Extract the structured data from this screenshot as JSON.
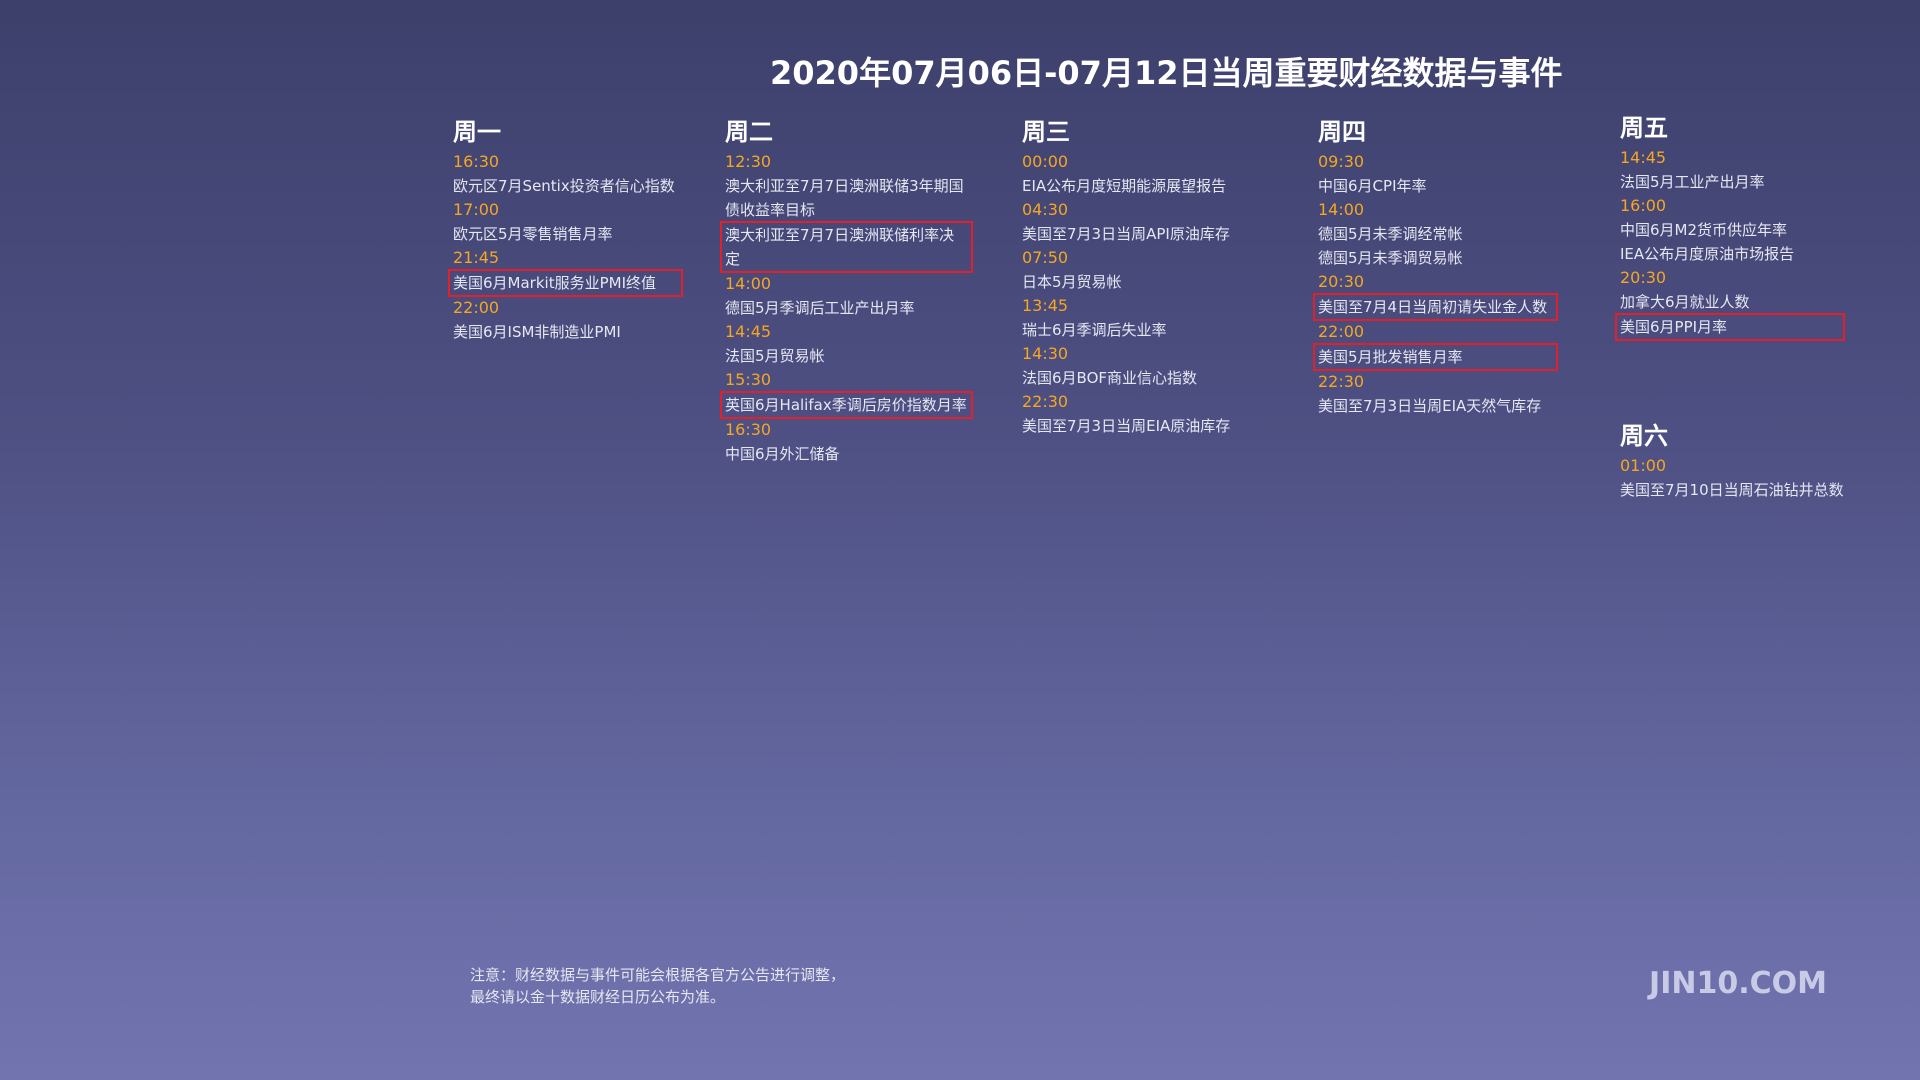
{
  "title": "2020年07月06日-07月12日当周重要财经数据与事件",
  "colors": {
    "time": "#f5a623",
    "highlight_border": "#e0202a",
    "text": "#e6e7f2"
  },
  "days": [
    {
      "name": "周一",
      "items": [
        {
          "time": "16:30",
          "events": [
            {
              "text": "欧元区7月Sentix投资者信心指数",
              "hl": false
            }
          ]
        },
        {
          "time": "17:00",
          "events": [
            {
              "text": "欧元区5月零售销售月率",
              "hl": false
            }
          ]
        },
        {
          "time": "21:45",
          "events": [
            {
              "text": "美国6月Markit服务业PMI终值",
              "hl": true
            }
          ]
        },
        {
          "time": "22:00",
          "events": [
            {
              "text": "美国6月ISM非制造业PMI",
              "hl": false
            }
          ]
        }
      ]
    },
    {
      "name": "周二",
      "items": [
        {
          "time": "12:30",
          "events": [
            {
              "text": "澳大利亚至7月7日澳洲联储3年期国债收益率目标",
              "hl": false
            },
            {
              "text": "澳大利亚至7月7日澳洲联储利率决定",
              "hl": true
            }
          ]
        },
        {
          "time": "14:00",
          "events": [
            {
              "text": "德国5月季调后工业产出月率",
              "hl": false
            }
          ]
        },
        {
          "time": "14:45",
          "events": [
            {
              "text": "法国5月贸易帐",
              "hl": false
            }
          ]
        },
        {
          "time": "15:30",
          "events": [
            {
              "text": "英国6月Halifax季调后房价指数月率",
              "hl": true
            }
          ]
        },
        {
          "time": "16:30",
          "events": [
            {
              "text": "中国6月外汇储备",
              "hl": false
            }
          ]
        }
      ]
    },
    {
      "name": "周三",
      "items": [
        {
          "time": "00:00",
          "events": [
            {
              "text": "EIA公布月度短期能源展望报告",
              "hl": false
            }
          ]
        },
        {
          "time": "04:30",
          "events": [
            {
              "text": "美国至7月3日当周API原油库存",
              "hl": false
            }
          ]
        },
        {
          "time": "07:50",
          "events": [
            {
              "text": "日本5月贸易帐",
              "hl": false
            }
          ]
        },
        {
          "time": "13:45",
          "events": [
            {
              "text": "瑞士6月季调后失业率",
              "hl": false
            }
          ]
        },
        {
          "time": "14:30",
          "events": [
            {
              "text": "法国6月BOF商业信心指数",
              "hl": false
            }
          ]
        },
        {
          "time": "22:30",
          "events": [
            {
              "text": "美国至7月3日当周EIA原油库存",
              "hl": false
            }
          ]
        }
      ]
    },
    {
      "name": "周四",
      "items": [
        {
          "time": "09:30",
          "events": [
            {
              "text": "中国6月CPI年率",
              "hl": false
            }
          ]
        },
        {
          "time": "14:00",
          "events": [
            {
              "text": "德国5月未季调经常帐",
              "hl": false
            },
            {
              "text": "德国5月未季调贸易帐",
              "hl": false
            }
          ]
        },
        {
          "time": "20:30",
          "events": [
            {
              "text": "美国至7月4日当周初请失业金人数",
              "hl": true
            }
          ]
        },
        {
          "time": "22:00",
          "events": [
            {
              "text": "美国5月批发销售月率",
              "hl": true
            }
          ]
        },
        {
          "time": "22:30",
          "events": [
            {
              "text": "美国至7月3日当周EIA天然气库存",
              "hl": false
            }
          ]
        }
      ]
    },
    {
      "name": "周五",
      "items": [
        {
          "time": "14:45",
          "events": [
            {
              "text": "法国5月工业产出月率",
              "hl": false
            }
          ]
        },
        {
          "time": "16:00",
          "events": [
            {
              "text": "中国6月M2货币供应年率",
              "hl": false
            },
            {
              "text": "IEA公布月度原油市场报告",
              "hl": false
            }
          ]
        },
        {
          "time": "20:30",
          "events": [
            {
              "text": "加拿大6月就业人数",
              "hl": false
            },
            {
              "text": "美国6月PPI月率",
              "hl": true
            }
          ]
        }
      ]
    },
    {
      "name": "周六",
      "items": [
        {
          "time": "01:00",
          "events": [
            {
              "text": "美国至7月10日当周石油钻井总数",
              "hl": false
            }
          ]
        }
      ]
    }
  ],
  "note": {
    "line1": "注意：财经数据与事件可能会根据各官方公告进行调整，",
    "line2": "最终请以金十数据财经日历公布为准。"
  },
  "brand": "JIN10.COM"
}
